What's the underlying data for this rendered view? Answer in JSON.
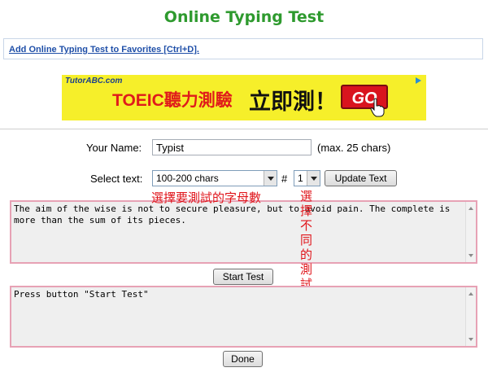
{
  "page": {
    "title": "Online Typing Test",
    "favorites_link": "Add Online Typing Test to Favorites [Ctrl+D]."
  },
  "ad": {
    "brand": "TutorABC.com",
    "headline": "TOEIC聽力測驗",
    "cta_text": "立即測！",
    "go_label": "GO",
    "accent_color": "#d9141e",
    "background_color": "#f6ef2a"
  },
  "form": {
    "name_label": "Your Name:",
    "name_value": "Typist",
    "name_hint": "(max. 25 chars)",
    "select_label": "Select text:",
    "char_range_selected": "100-200 chars",
    "hash_label": "#",
    "text_number_selected": "1",
    "update_button": "Update Text"
  },
  "annotations": {
    "char_count_note": "選擇要測試的字母數",
    "text_choice_note": "選擇不同的測試文章",
    "color": "#e0151b"
  },
  "source_text": "The aim of the wise is not to secure pleasure, but to avoid pain. The complete is more than the sum of its pieces.",
  "start_button": "Start Test",
  "input_text": "Press button \"Start Test\"",
  "done_button": "Done"
}
